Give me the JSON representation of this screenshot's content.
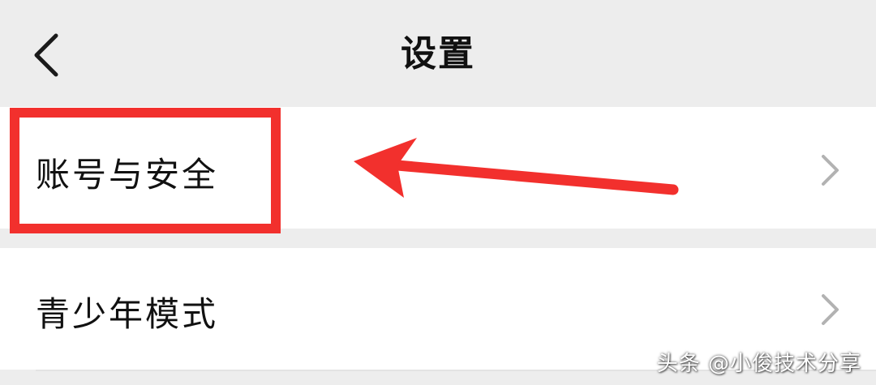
{
  "nav": {
    "title": "设置",
    "back_icon": "chevron-left-icon"
  },
  "settings": {
    "items": [
      {
        "label": "账号与安全",
        "icon": "chevron-right-icon"
      },
      {
        "label": "青少年模式",
        "icon": "chevron-right-icon"
      }
    ]
  },
  "annotation": {
    "box_color": "#f2302d",
    "arrow_color": "#f2302d"
  },
  "watermark": {
    "text": "头条 @小俊技术分享"
  },
  "colors": {
    "background": "#ededed",
    "row_background": "#ffffff",
    "text": "#111111",
    "chevron": "#b2b2b2"
  }
}
